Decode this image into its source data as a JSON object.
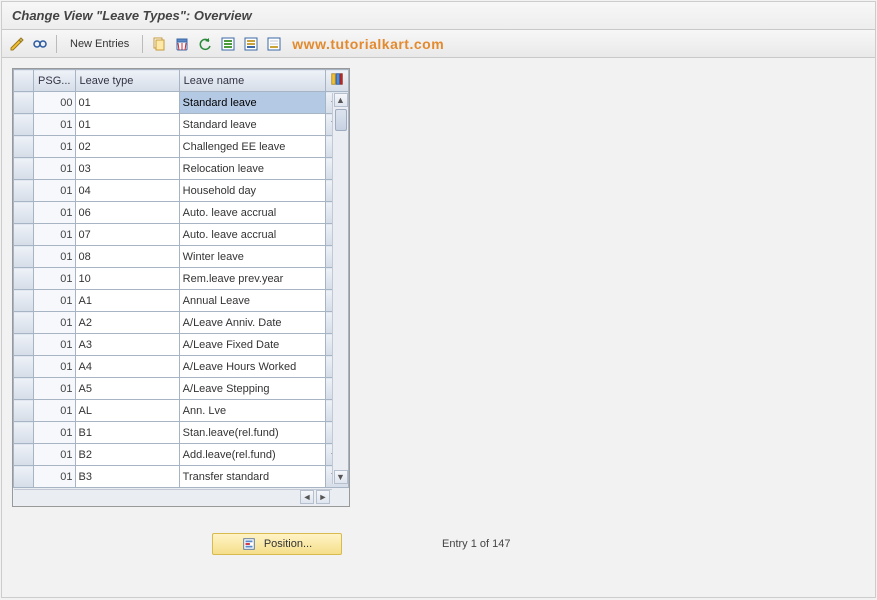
{
  "title": "Change View \"Leave Types\": Overview",
  "toolbar": {
    "new_entries_label": "New Entries",
    "watermark": "www.tutorialkart.com"
  },
  "columns": {
    "psg": "PSG...",
    "leave_type": "Leave type",
    "leave_name": "Leave name"
  },
  "rows": [
    {
      "psg": "00",
      "type": "01",
      "name": "Standard leave",
      "selected": true
    },
    {
      "psg": "01",
      "type": "01",
      "name": "Standard leave"
    },
    {
      "psg": "01",
      "type": "02",
      "name": "Challenged EE leave"
    },
    {
      "psg": "01",
      "type": "03",
      "name": "Relocation leave"
    },
    {
      "psg": "01",
      "type": "04",
      "name": "Household day"
    },
    {
      "psg": "01",
      "type": "06",
      "name": "Auto. leave accrual"
    },
    {
      "psg": "01",
      "type": "07",
      "name": "Auto. leave accrual"
    },
    {
      "psg": "01",
      "type": "08",
      "name": "Winter leave"
    },
    {
      "psg": "01",
      "type": "10",
      "name": "Rem.leave prev.year"
    },
    {
      "psg": "01",
      "type": "A1",
      "name": "Annual Leave"
    },
    {
      "psg": "01",
      "type": "A2",
      "name": "A/Leave Anniv. Date"
    },
    {
      "psg": "01",
      "type": "A3",
      "name": "A/Leave Fixed Date"
    },
    {
      "psg": "01",
      "type": "A4",
      "name": "A/Leave Hours Worked"
    },
    {
      "psg": "01",
      "type": "A5",
      "name": "A/Leave Stepping"
    },
    {
      "psg": "01",
      "type": "AL",
      "name": "Ann. Lve"
    },
    {
      "psg": "01",
      "type": "B1",
      "name": "Stan.leave(rel.fund)"
    },
    {
      "psg": "01",
      "type": "B2",
      "name": "Add.leave(rel.fund)"
    },
    {
      "psg": "01",
      "type": "B3",
      "name": "Transfer standard"
    }
  ],
  "footer": {
    "position_label": "Position...",
    "status": "Entry 1 of 147"
  }
}
